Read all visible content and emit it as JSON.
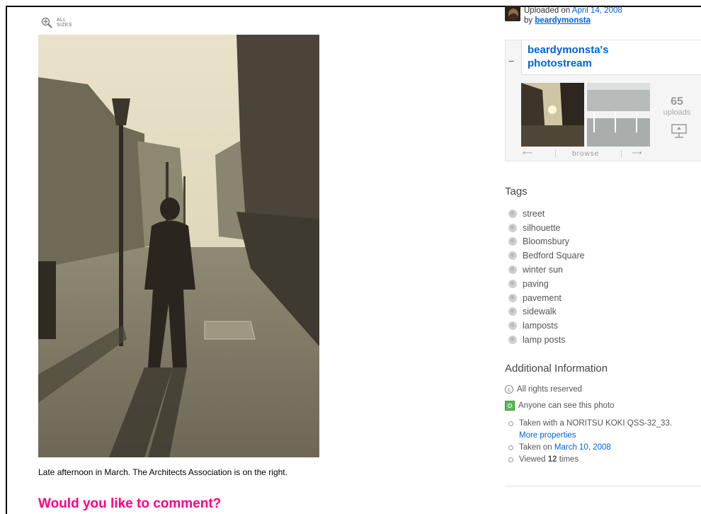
{
  "toolbar": {
    "all_sizes_label": "ALL SIZES"
  },
  "photo": {
    "caption": "Late afternoon in March. The Architects Association is on the right."
  },
  "comments": {
    "prompt": "Would you like to comment?"
  },
  "uploader": {
    "uploaded_prefix": "Uploaded on",
    "date": "April 14, 2008",
    "by_prefix": "by",
    "username": "beardymonsta"
  },
  "photostream": {
    "title": "beardymonsta's photostream",
    "collapse_symbol": "−",
    "uploads_count": "65",
    "uploads_label": "uploads",
    "browse_label": "browse"
  },
  "tags": {
    "heading": "Tags",
    "items": [
      "street",
      "silhouette",
      "Bloomsbury",
      "Bedford Square",
      "winter sun",
      "paving",
      "pavement",
      "sidewalk",
      "lamposts",
      "lamp posts"
    ]
  },
  "additional_info": {
    "heading": "Additional Information",
    "license": "All rights reserved",
    "license_symbol": "c",
    "privacy": "Anyone can see this photo",
    "camera_prefix": "Taken with a NORITSU KOKI QSS-32_33.",
    "more_properties": "More properties",
    "taken_prefix": "Taken on",
    "taken_date": "March 10, 2008",
    "viewed_prefix": "Viewed",
    "viewed_count": "12",
    "viewed_suffix": "times"
  },
  "colors": {
    "link": "#0063dc",
    "accent": "#ff0084"
  }
}
